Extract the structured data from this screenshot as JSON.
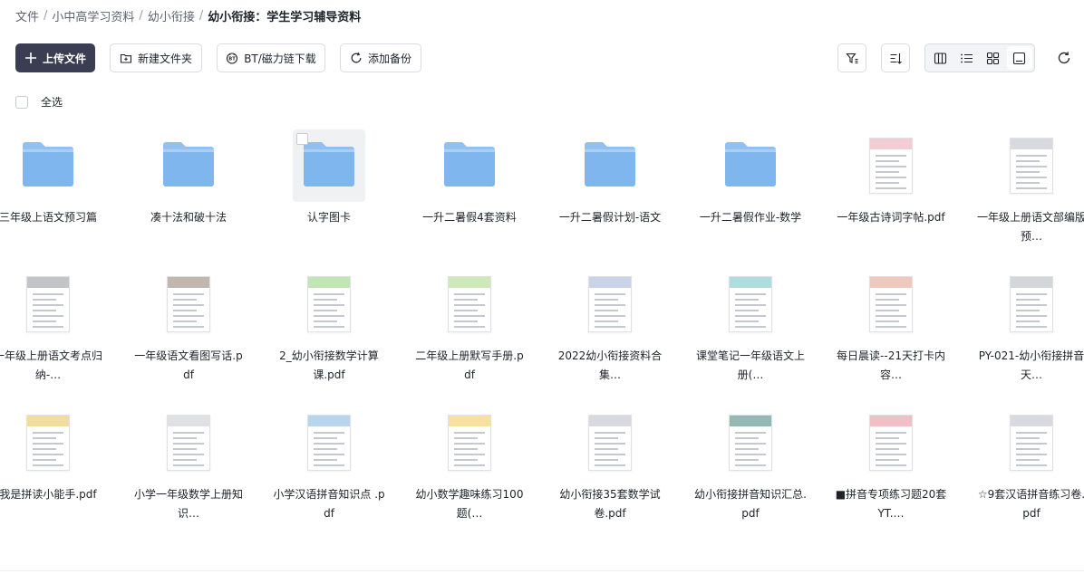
{
  "breadcrumb": [
    "文件",
    "小中高学习资料",
    "幼小衔接",
    "幼小衔接：学生学习辅导资料"
  ],
  "toolbar": {
    "upload_label": "上传文件",
    "new_folder_label": "新建文件夹",
    "bt_label": "BT/磁力链下载",
    "backup_label": "添加备份"
  },
  "select_all_label": "全选",
  "colors": {
    "primary": "#3b3d52",
    "folder": "#7fb6ee"
  },
  "items": [
    {
      "name": "三年级上语文预习篇",
      "kind": "folder"
    },
    {
      "name": "凑十法和破十法",
      "kind": "folder"
    },
    {
      "name": "认字图卡",
      "kind": "folder"
    },
    {
      "name": "一升二暑假4套资料",
      "kind": "folder"
    },
    {
      "name": "一升二暑假计划-语文",
      "kind": "folder"
    },
    {
      "name": "一升二暑假作业-数学",
      "kind": "folder"
    },
    {
      "name": "一年级古诗词字帖.pdf",
      "kind": "pdf",
      "accent": "#e7a4b0"
    },
    {
      "name": "一年级上册语文部编版预…",
      "kind": "pdf",
      "accent": "#b8bcc4"
    },
    {
      "name": "一年级上册语文考点归纳-…",
      "kind": "pdf",
      "accent": "#8f939b"
    },
    {
      "name": "一年级语文看图写话.pdf",
      "kind": "pdf",
      "accent": "#8f7b6b"
    },
    {
      "name": "2_幼小衔接数学计算课.pdf",
      "kind": "pdf",
      "accent": "#8fcf7a"
    },
    {
      "name": "二年级上册默写手册.pdf",
      "kind": "pdf",
      "accent": "#a6d77c"
    },
    {
      "name": "2022幼小衔接资料合集…",
      "kind": "pdf",
      "accent": "#9fb0d6"
    },
    {
      "name": "课堂笔记一年级语文上册(…",
      "kind": "pdf",
      "accent": "#6cc0c4"
    },
    {
      "name": "每日晨读--21天打卡内容…",
      "kind": "pdf",
      "accent": "#e39a8c"
    },
    {
      "name": "PY-021-幼小衔接拼音天…",
      "kind": "pdf",
      "accent": "#b0b4bc"
    },
    {
      "name": "我是拼读小能手.pdf",
      "kind": "pdf",
      "accent": "#e8c24b"
    },
    {
      "name": "小学一年级数学上册知识…",
      "kind": "pdf",
      "accent": "#c5c8cf"
    },
    {
      "name": "小学汉语拼音知识点 .pdf",
      "kind": "pdf",
      "accent": "#7fb3e0"
    },
    {
      "name": "幼小数学趣味练习100题(…",
      "kind": "pdf",
      "accent": "#f0c84a"
    },
    {
      "name": "幼小衔接35套数学试卷.pdf",
      "kind": "pdf",
      "accent": "#b8bcc4"
    },
    {
      "name": "幼小衔接拼音知识汇总.pdf",
      "kind": "pdf",
      "accent": "#3d7f77"
    },
    {
      "name": "■拼音专项练习题20套YT.…",
      "kind": "pdf",
      "accent": "#e58b97"
    },
    {
      "name": "☆9套汉语拼音练习卷.pdf",
      "kind": "pdf",
      "accent": "#b8bcc4"
    }
  ]
}
